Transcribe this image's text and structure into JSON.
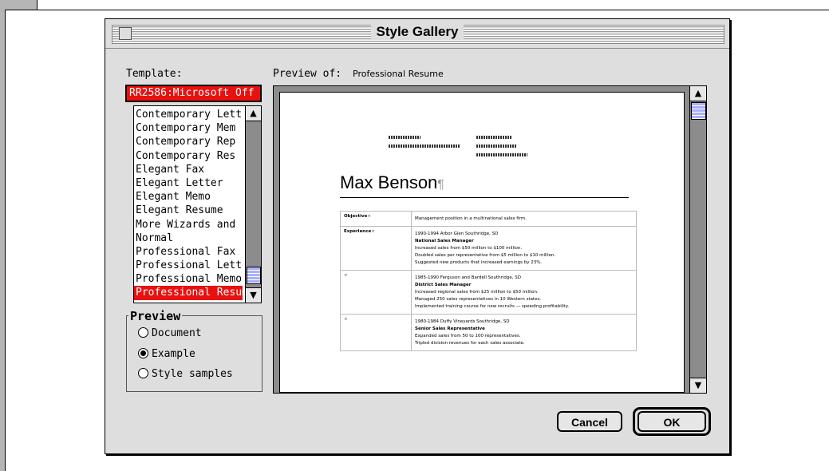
{
  "dialog": {
    "title": "Style Gallery",
    "template_label": "Template:",
    "template_selected": "RR2586:Microsoft Off",
    "preview_of_label": "Preview of:",
    "preview_of_value": "Professional Resume",
    "templates": [
      "Contemporary Lett",
      "Contemporary Mem",
      "Contemporary Rep",
      "Contemporary Res",
      "Elegant Fax",
      "Elegant Letter",
      "Elegant Memo",
      "Elegant Resume",
      "More Wizards and",
      "Normal",
      "Professional Fax",
      "Professional Letter",
      "Professional Memo",
      "Professional Resum"
    ],
    "selected_template_index": 13,
    "preview_group": {
      "legend": "Preview",
      "options": [
        "Document",
        "Example",
        "Style samples"
      ],
      "selected": "Example"
    },
    "buttons": {
      "cancel": "Cancel",
      "ok": "OK"
    }
  },
  "resume": {
    "name": "Max Benson",
    "para_mark": "¶",
    "cell_mark": "×",
    "rows": [
      {
        "label": "Objective",
        "lines": [
          "Management position in a multinational sales firm."
        ]
      },
      {
        "label": "Experience",
        "lines": [
          "1990-1994  Arbor Glen  Southridge, SD",
          "National Sales Manager",
          "Increased sales from $50 million to $100 million.",
          "Doubled sales per representative from $5 million to $10 million.",
          "Suggested new products that increased earnings by 23%."
        ]
      },
      {
        "label": "",
        "lines": [
          "1985-1990  Ferguson and Bardell  Southridge, SD",
          "District Sales Manager",
          "Increased regional sales from $25 million to $50 million.",
          "Managed 250 sales representatives in 10 Western states.",
          "Implemented training course for new recruits — speeding profitability."
        ]
      },
      {
        "label": "",
        "lines": [
          "1980-1984  Duffy Vineyards  Southridge, SD",
          "Senior Sales Representative",
          "Expanded sales from 50 to 100 representatives.",
          "Tripled division revenues for each sales associate."
        ]
      }
    ]
  }
}
